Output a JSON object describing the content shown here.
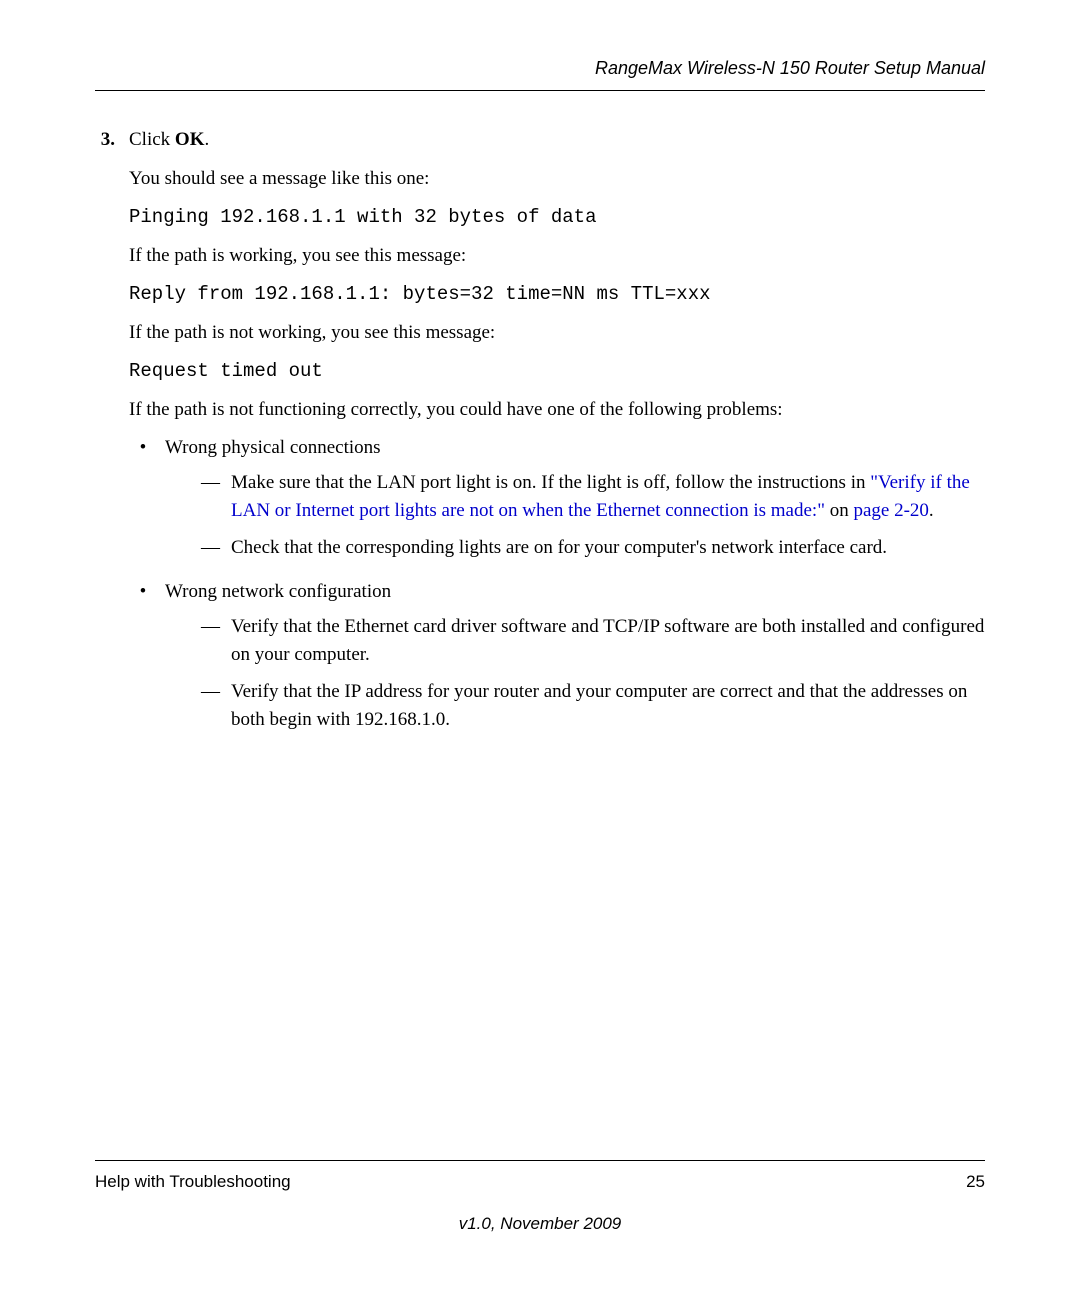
{
  "header": {
    "title": "RangeMax Wireless-N 150 Router Setup Manual"
  },
  "step": {
    "number": "3.",
    "instruction_prefix": "Click ",
    "instruction_bold": "OK",
    "instruction_suffix": "."
  },
  "body": {
    "see_message": "You should see a message like this one:",
    "ping_line": "Pinging 192.168.1.1 with 32 bytes of data",
    "working": "If the path is working, you see this message:",
    "reply_line": "Reply from 192.168.1.1: bytes=32 time=NN ms TTL=xxx",
    "not_working": "If the path is not working, you see this message:",
    "timeout_line": "Request timed out",
    "not_func": "If the path is not functioning correctly, you could have one of the following problems:"
  },
  "bullets": [
    {
      "label": "Wrong physical connections",
      "dashes": [
        {
          "prefix": "Make sure that the LAN port light is on. If the light is off, follow the instructions in ",
          "link1": "\"Verify if the LAN or Internet port lights are not on when the Ethernet connection is made:\"",
          "middle": " on ",
          "link2": "page 2-20",
          "suffix": "."
        },
        {
          "text": "Check that the corresponding lights are on for your computer's network interface card."
        }
      ]
    },
    {
      "label": "Wrong network configuration",
      "dashes": [
        {
          "text": "Verify that the Ethernet card driver software and TCP/IP software are both installed and configured on your computer."
        },
        {
          "text": "Verify that the IP address for your router and your computer are correct and that the addresses on both begin with 192.168.1.0."
        }
      ]
    }
  ],
  "footer": {
    "section": "Help with Troubleshooting",
    "page": "25",
    "version": "v1.0, November 2009"
  }
}
